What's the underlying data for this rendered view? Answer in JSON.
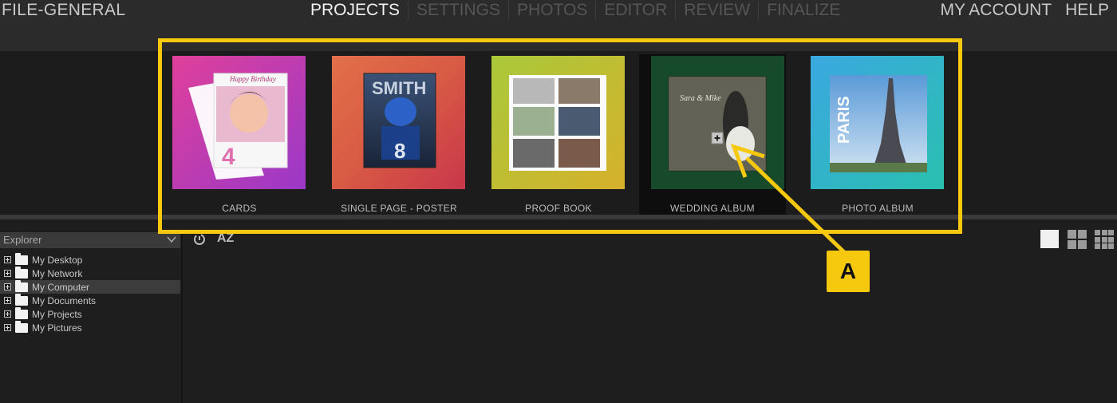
{
  "brand": "FILE-GENERAL",
  "nav": [
    "PROJECTS",
    "SETTINGS",
    "PHOTOS",
    "EDITOR",
    "REVIEW",
    "FINALIZE"
  ],
  "active_nav": "PROJECTS",
  "right_nav": {
    "account": "MY ACCOUNT",
    "help": "HELP"
  },
  "projects": [
    {
      "label": "CARDS",
      "thumb_title": "Happy Birthday",
      "thumb_number": "4"
    },
    {
      "label": "SINGLE PAGE - POSTER",
      "thumb_title": "SMITH",
      "thumb_number": "8"
    },
    {
      "label": "PROOF BOOK"
    },
    {
      "label": "WEDDING ALBUM",
      "thumb_title": "Sara & Mike",
      "selected": true
    },
    {
      "label": "PHOTO ALBUM",
      "thumb_title": "PARIS"
    }
  ],
  "callout": "A",
  "explorer": {
    "title": "Explorer",
    "items": [
      "My Desktop",
      "My Network",
      "My Computer",
      "My Documents",
      "My Projects",
      "My Pictures"
    ],
    "selected": "My Computer"
  },
  "toolbar": {
    "az": "AZ"
  },
  "colors": {
    "highlight": "#f6c90e",
    "active_nav": "#f2f2f2"
  }
}
